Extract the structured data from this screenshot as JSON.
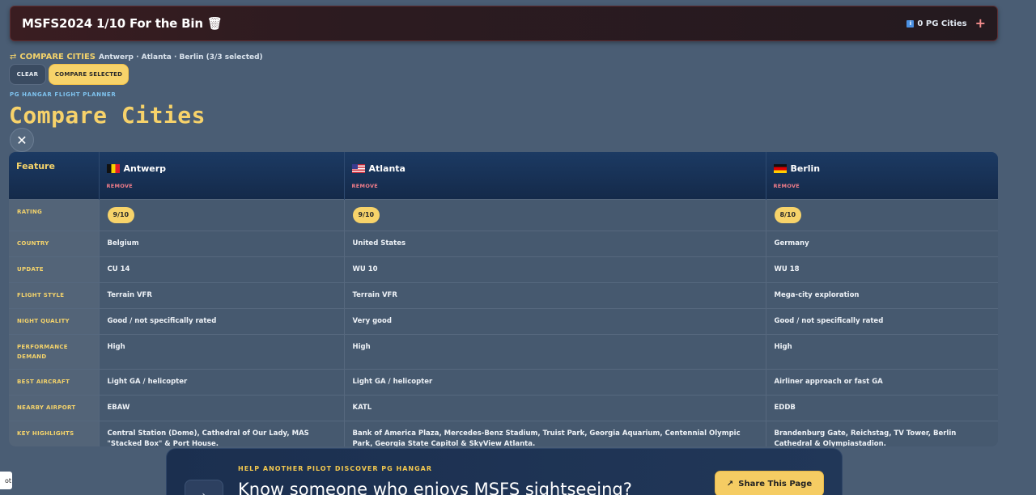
{
  "header": {
    "title": "MSFS2024 1/10 For the Bin",
    "bin_icon": "bin-icon",
    "pg_cities": "0 PG Cities",
    "info_icon": "info-icon",
    "add_icon": "plus-icon"
  },
  "compare_bar": {
    "label": "COMPARE CITIES",
    "selection": "Antwerp · Atlanta · Berlin (3/3 selected)",
    "clear": "CLEAR",
    "compare": "COMPARE SELECTED"
  },
  "page": {
    "kicker": "PG HANGAR FLIGHT PLANNER",
    "title": "Compare Cities",
    "close": "✕"
  },
  "table": {
    "feature_header": "Feature",
    "remove_label": "REMOVE",
    "cities": [
      {
        "name": "Antwerp",
        "flag": "belgium"
      },
      {
        "name": "Atlanta",
        "flag": "usa"
      },
      {
        "name": "Berlin",
        "flag": "germany"
      }
    ],
    "rows": [
      {
        "label": "RATING",
        "values": [
          "9/10",
          "9/10",
          "8/10"
        ],
        "pill": true
      },
      {
        "label": "COUNTRY",
        "values": [
          "Belgium",
          "United States",
          "Germany"
        ]
      },
      {
        "label": "UPDATE",
        "values": [
          "CU 14",
          "WU 10",
          "WU 18"
        ]
      },
      {
        "label": "FLIGHT STYLE",
        "values": [
          "Terrain VFR",
          "Terrain VFR",
          "Mega-city exploration"
        ]
      },
      {
        "label": "NIGHT QUALITY",
        "values": [
          "Good / not specifically rated",
          "Very good",
          "Good / not specifically rated"
        ]
      },
      {
        "label": "PERFORMANCE DEMAND",
        "values": [
          "High",
          "High",
          "High"
        ]
      },
      {
        "label": "BEST AIRCRAFT",
        "values": [
          "Light GA / helicopter",
          "Light GA / helicopter",
          "Airliner approach or fast GA"
        ]
      },
      {
        "label": "NEARBY AIRPORT",
        "values": [
          "EBAW",
          "KATL",
          "EDDB"
        ]
      },
      {
        "label": "KEY HIGHLIGHTS",
        "values": [
          "Central Station (Dome), Cathedral of Our Lady, MAS \"Stacked Box\" & Port House.",
          "Bank of America Plaza, Mercedes-Benz Stadium, Truist Park, Georgia Aquarium, Centennial Olympic Park, Georgia State Capitol & SkyView Atlanta.",
          "Brandenburg Gate, Reichstag, TV Tower, Berlin Cathedral & Olympiastadion."
        ]
      }
    ]
  },
  "banner": {
    "eyebrow": "HELP ANOTHER PILOT DISCOVER PG HANGAR",
    "headline": "Know someone who enjoys MSFS sightseeing?",
    "share": "Share This Page"
  },
  "corner": {
    "text": "ot"
  }
}
